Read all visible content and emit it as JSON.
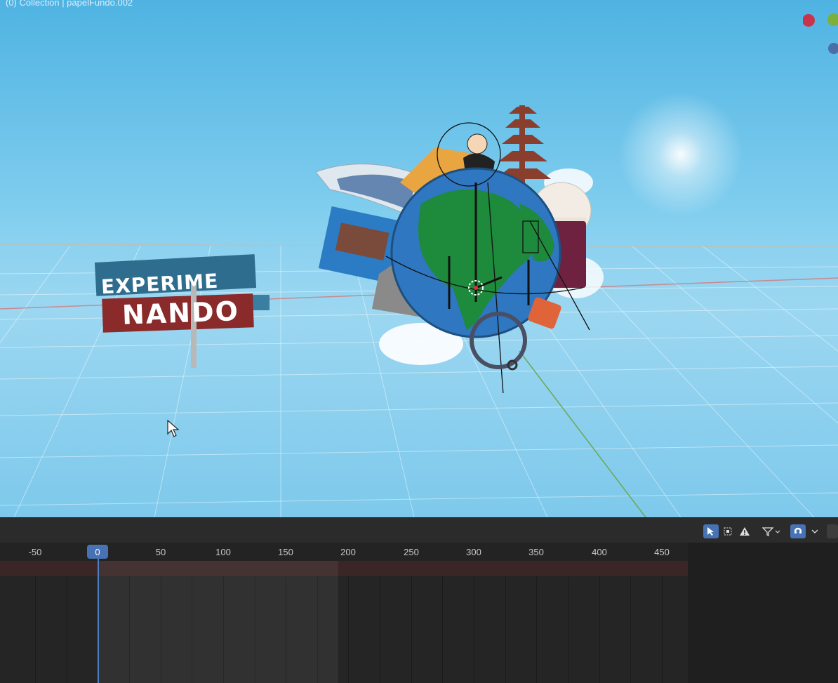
{
  "viewport": {
    "header_text": "(0) Collection | papelFundo.002",
    "sign": {
      "line1": "EXPERIME",
      "line2": "NANDO"
    },
    "icons": [
      "cursor-arrow-icon",
      "axis-gizmo-icon"
    ]
  },
  "timeline": {
    "current_frame": "0",
    "ruler_labels": [
      "-50",
      "50",
      "100",
      "150",
      "200",
      "250",
      "300",
      "350",
      "400",
      "450"
    ],
    "tools": [
      "select-icon",
      "box-select-icon",
      "warning-icon",
      "filter-icon",
      "snap-icon"
    ],
    "colors": {
      "accent": "#4772b3",
      "range": "#3a2626"
    }
  }
}
